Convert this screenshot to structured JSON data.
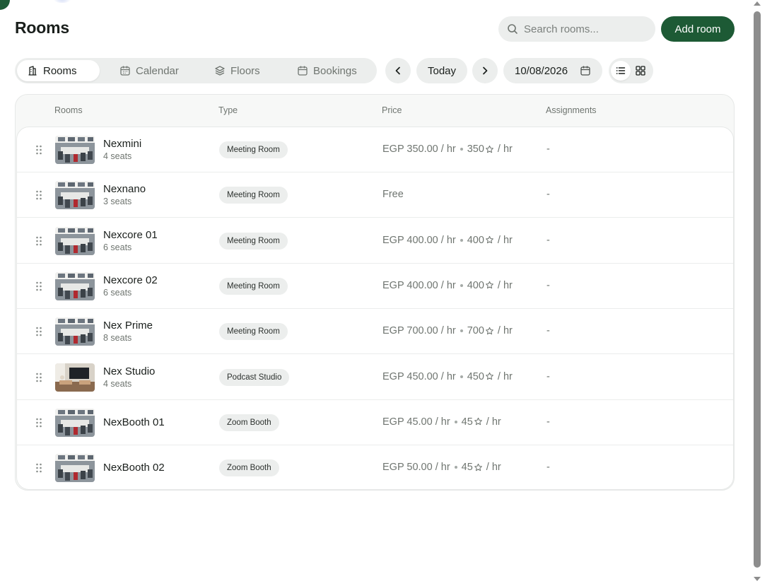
{
  "colors": {
    "accent": "#1d5a35",
    "muted_bg": "#eceeed",
    "muted_text": "#6f7570"
  },
  "header": {
    "title": "Rooms",
    "search_placeholder": "Search rooms...",
    "add_label": "Add room"
  },
  "tabs": [
    {
      "label": "Rooms",
      "icon": "building-icon",
      "active": true
    },
    {
      "label": "Calendar",
      "icon": "calendar-icon",
      "active": false
    },
    {
      "label": "Floors",
      "icon": "layers-icon",
      "active": false
    },
    {
      "label": "Bookings",
      "icon": "calendar-icon",
      "active": false
    }
  ],
  "date_nav": {
    "prev_icon": "chevron-left-icon",
    "today_label": "Today",
    "next_icon": "chevron-right-icon",
    "date_value": "10/08/2026"
  },
  "view_toggle": {
    "list_icon": "list-icon",
    "grid_icon": "grid-icon",
    "active": "list"
  },
  "table": {
    "columns": [
      "Rooms",
      "Type",
      "Price",
      "Assignments"
    ],
    "rows": [
      {
        "name": "Nexmini",
        "seats": "4 seats",
        "type": "Meeting Room",
        "price": "EGP 350.00 / hr",
        "credits": "350",
        "credit_unit": "/ hr",
        "assignments": "-",
        "photo": "meeting"
      },
      {
        "name": "Nexnano",
        "seats": "3 seats",
        "type": "Meeting Room",
        "price": "Free",
        "credits": "",
        "credit_unit": "",
        "assignments": "-",
        "photo": "meeting"
      },
      {
        "name": "Nexcore 01",
        "seats": "6 seats",
        "type": "Meeting Room",
        "price": "EGP 400.00 / hr",
        "credits": "400",
        "credit_unit": "/ hr",
        "assignments": "-",
        "photo": "meeting"
      },
      {
        "name": "Nexcore 02",
        "seats": "6 seats",
        "type": "Meeting Room",
        "price": "EGP 400.00 / hr",
        "credits": "400",
        "credit_unit": "/ hr",
        "assignments": "-",
        "photo": "meeting"
      },
      {
        "name": "Nex Prime",
        "seats": "8 seats",
        "type": "Meeting Room",
        "price": "EGP 700.00 / hr",
        "credits": "700",
        "credit_unit": "/ hr",
        "assignments": "-",
        "photo": "meeting"
      },
      {
        "name": "Nex Studio",
        "seats": "4 seats",
        "type": "Podcast Studio",
        "price": "EGP 450.00 / hr",
        "credits": "450",
        "credit_unit": "/ hr",
        "assignments": "-",
        "photo": "studio"
      },
      {
        "name": "NexBooth 01",
        "seats": "",
        "type": "Zoom Booth",
        "price": "EGP 45.00 / hr",
        "credits": "45",
        "credit_unit": "/ hr",
        "assignments": "-",
        "photo": "meeting"
      },
      {
        "name": "NexBooth 02",
        "seats": "",
        "type": "Zoom Booth",
        "price": "EGP 50.00 / hr",
        "credits": "45",
        "credit_unit": "/ hr",
        "assignments": "-",
        "photo": "meeting"
      }
    ]
  }
}
